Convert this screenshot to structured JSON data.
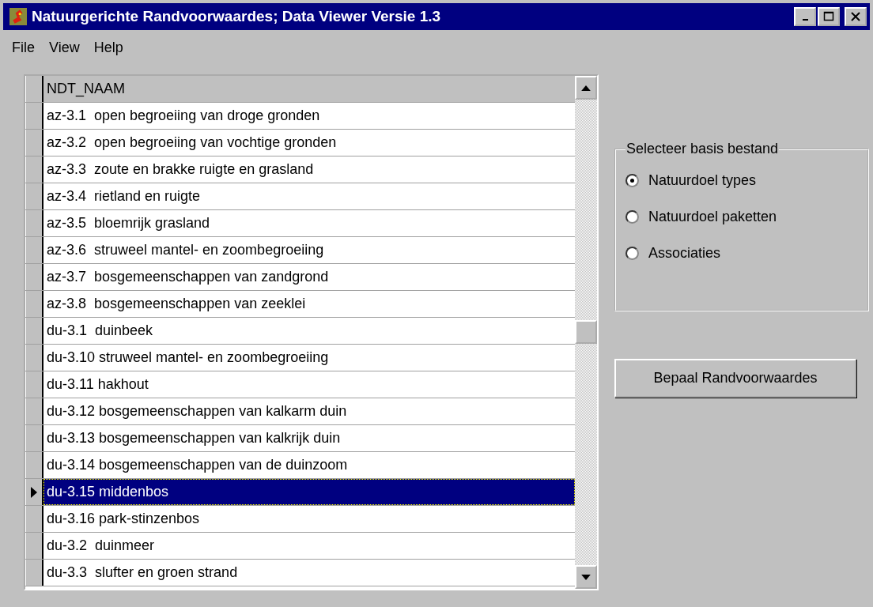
{
  "window": {
    "title": "Natuurgerichte Randvoorwaardes; Data Viewer Versie 1.3"
  },
  "menu": [
    "File",
    "View",
    "Help"
  ],
  "grid": {
    "column": "NDT_NAAM",
    "rows": [
      {
        "text": "az-3.1  open begroeiing van droge gronden",
        "selected": false
      },
      {
        "text": "az-3.2  open begroeiing van vochtige gronden",
        "selected": false
      },
      {
        "text": "az-3.3  zoute en brakke ruigte en grasland",
        "selected": false
      },
      {
        "text": "az-3.4  rietland en ruigte",
        "selected": false
      },
      {
        "text": "az-3.5  bloemrijk grasland",
        "selected": false
      },
      {
        "text": "az-3.6  struweel mantel- en zoombegroeiing",
        "selected": false
      },
      {
        "text": "az-3.7  bosgemeenschappen van zandgrond",
        "selected": false
      },
      {
        "text": "az-3.8  bosgemeenschappen van zeeklei",
        "selected": false
      },
      {
        "text": "du-3.1  duinbeek",
        "selected": false
      },
      {
        "text": "du-3.10 struweel mantel- en zoombegroeiing",
        "selected": false
      },
      {
        "text": "du-3.11 hakhout",
        "selected": false
      },
      {
        "text": "du-3.12 bosgemeenschappen van kalkarm duin",
        "selected": false
      },
      {
        "text": "du-3.13 bosgemeenschappen van kalkrijk duin",
        "selected": false
      },
      {
        "text": "du-3.14 bosgemeenschappen van de duinzoom",
        "selected": false
      },
      {
        "text": "du-3.15 middenbos",
        "selected": true
      },
      {
        "text": "du-3.16 park-stinzenbos",
        "selected": false
      },
      {
        "text": "du-3.2  duinmeer",
        "selected": false
      },
      {
        "text": "du-3.3  slufter en groen strand",
        "selected": false
      }
    ]
  },
  "group": {
    "title": "Selecteer basis bestand",
    "options": [
      {
        "label": "Natuurdoel types",
        "selected": true
      },
      {
        "label": "Natuurdoel paketten",
        "selected": false
      },
      {
        "label": "Associaties",
        "selected": false
      }
    ]
  },
  "button": "Bepaal Randvoorwaardes"
}
